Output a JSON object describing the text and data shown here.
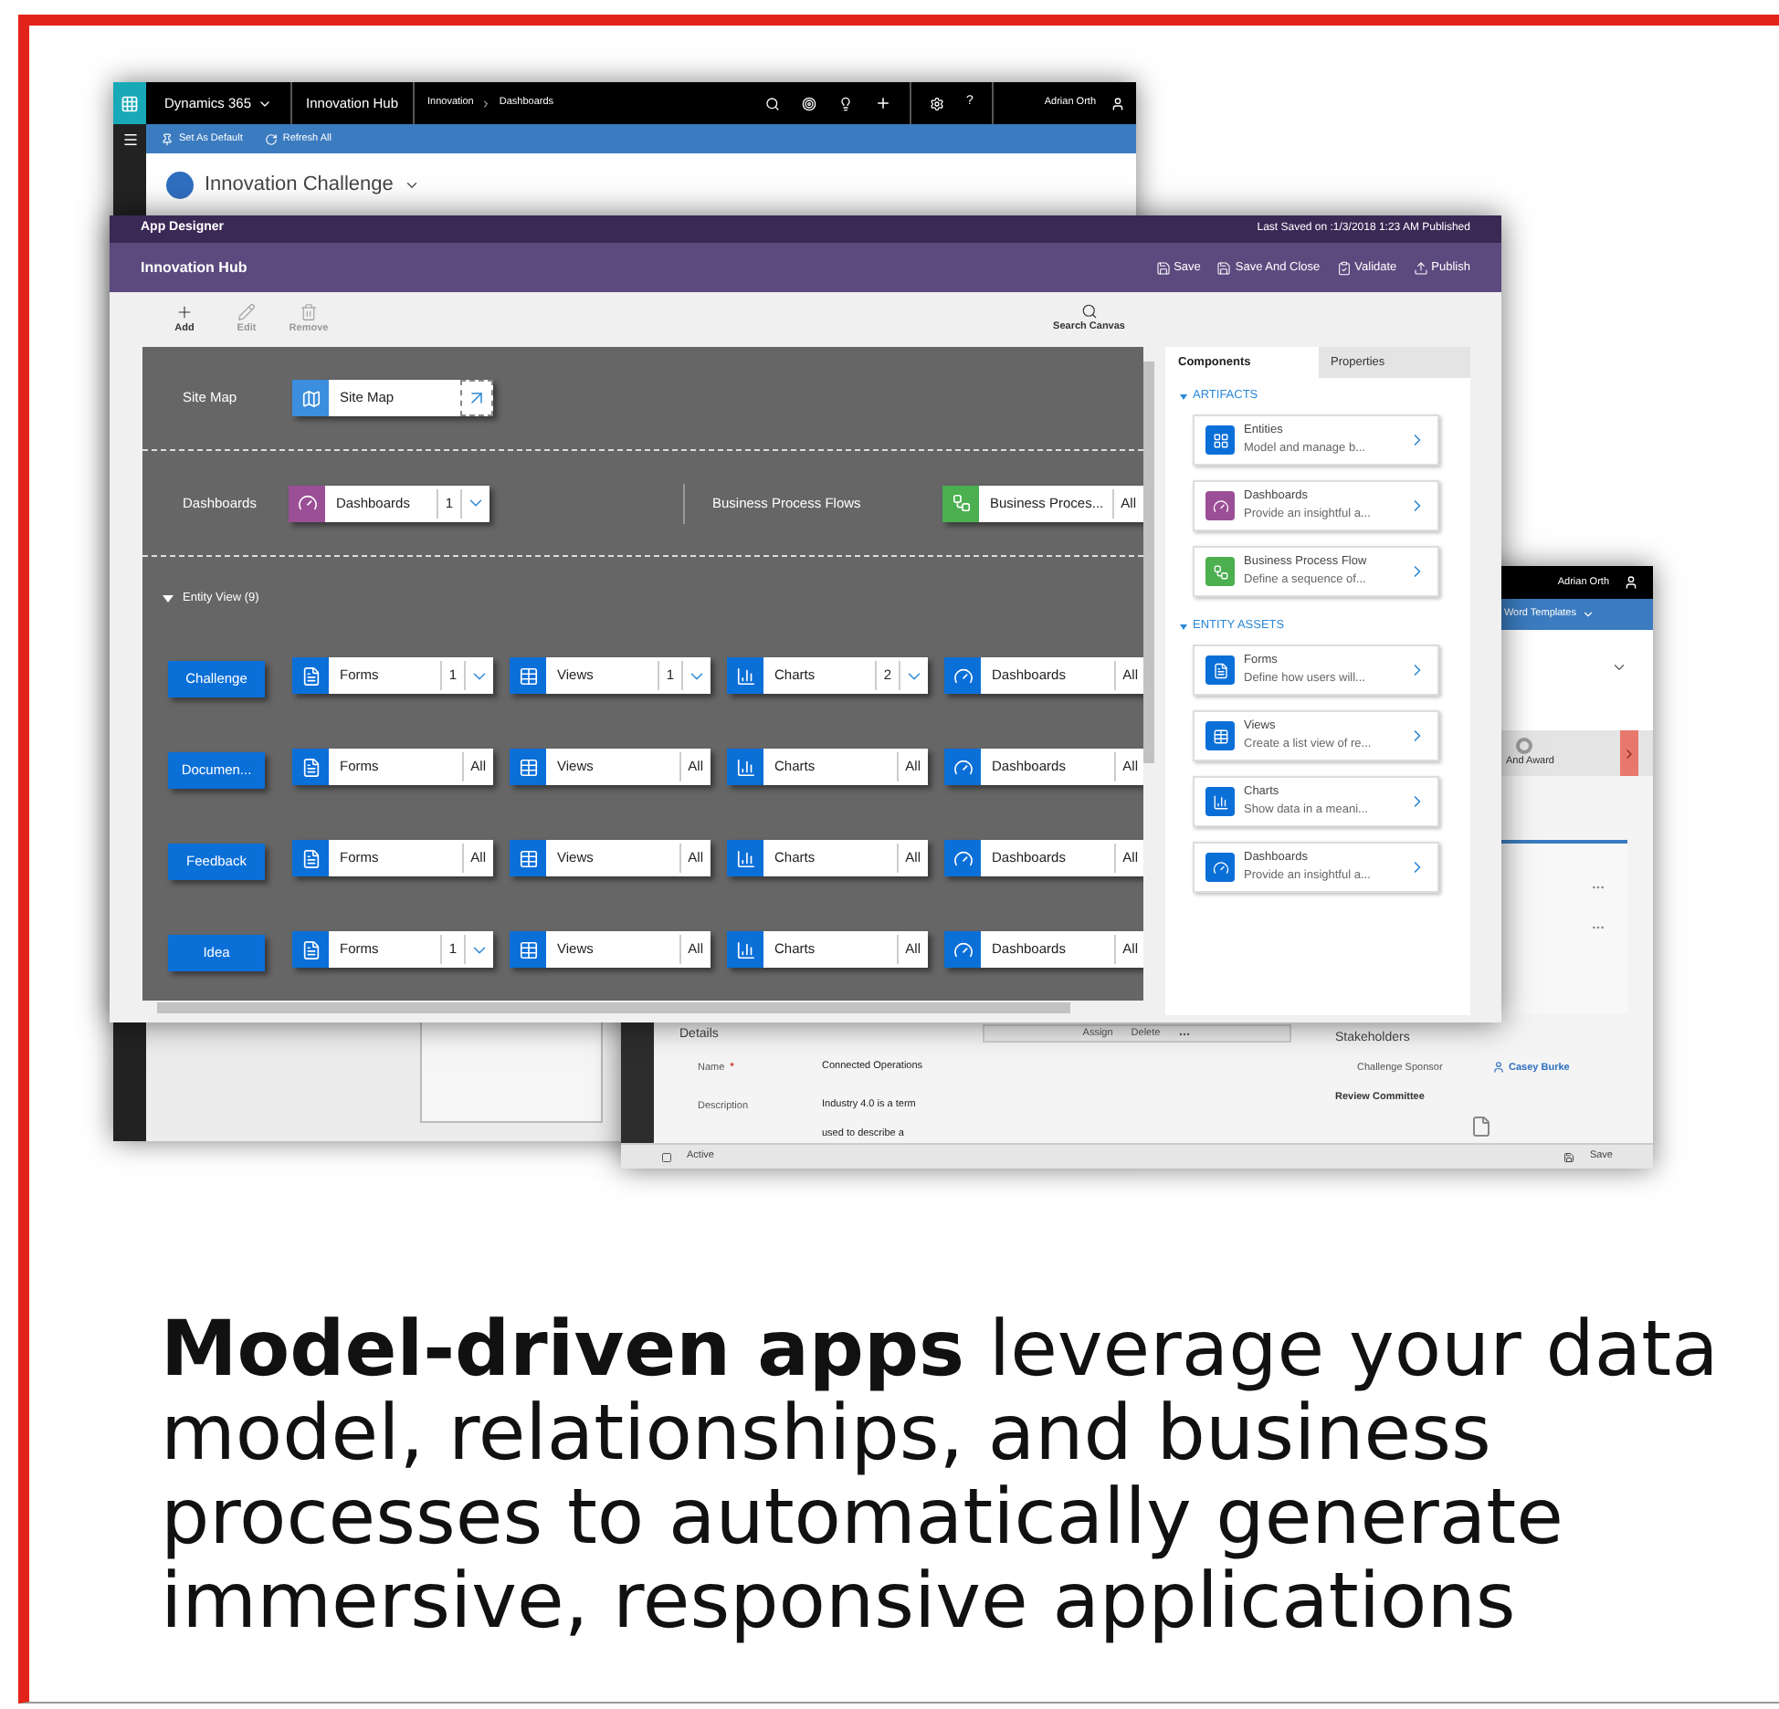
{
  "back_window": {
    "app_name": "Dynamics 365",
    "app": "Innovation Hub",
    "breadcrumb": [
      "Innovation",
      "Dashboards"
    ],
    "help": "?",
    "user": "Adrian Orth",
    "commands": [
      "Set As Default",
      "Refresh All"
    ],
    "dashboard_title": "Innovation Challenge"
  },
  "record_window": {
    "user": "Adrian Orth",
    "command": "Word Templates",
    "stage": "And Award",
    "details_title": "Details",
    "fields": [
      {
        "label": "Name",
        "required_mark": "*",
        "value": "Connected Operations"
      },
      {
        "label": "Description",
        "value": "Industry 4.0 is a term used to describe a"
      }
    ],
    "actions": [
      "Assign",
      "Delete"
    ],
    "stakeholders_title": "Stakeholders",
    "sponsor_label": "Challenge Sponsor",
    "sponsor": "Casey Burke",
    "committee": "Review Committee",
    "status": "Active",
    "save": "Save"
  },
  "designer": {
    "title": "App Designer",
    "last_saved": "Last Saved on :1/3/2018 1:23 AM Published",
    "app_name": "Innovation Hub",
    "actions": [
      {
        "kind": "save",
        "label": "Save"
      },
      {
        "kind": "save_close",
        "label": "Save And Close"
      },
      {
        "kind": "validate",
        "label": "Validate"
      },
      {
        "kind": "publish",
        "label": "Publish"
      }
    ],
    "toolbar": [
      {
        "kind": "add",
        "label": "Add",
        "disabled": false
      },
      {
        "kind": "edit",
        "label": "Edit",
        "disabled": true
      },
      {
        "kind": "remove",
        "label": "Remove",
        "disabled": true
      }
    ],
    "search": "Search Canvas",
    "site_map": {
      "label": "Site Map",
      "tile": {
        "kind": "sitemap",
        "label": "Site Map"
      }
    },
    "dashboards": {
      "label": "Dashboards",
      "tile": {
        "kind": "app_dashboards",
        "label": "Dashboards",
        "count": "1",
        "dropdown": true
      }
    },
    "process_flows": {
      "label": "Business Process Flows",
      "tile": {
        "kind": "bpf",
        "label": "Business Proces...",
        "count": "All",
        "dropdown": false
      }
    },
    "entity_view": {
      "label": "Entity View (9)",
      "expanded": true
    },
    "entities": [
      {
        "name": "Challenge",
        "assets": [
          {
            "kind": "forms",
            "label": "Forms",
            "count": "1",
            "dropdown": true
          },
          {
            "kind": "views",
            "label": "Views",
            "count": "1",
            "dropdown": true
          },
          {
            "kind": "charts",
            "label": "Charts",
            "count": "2",
            "dropdown": true
          },
          {
            "kind": "dashboards",
            "label": "Dashboards",
            "count": "All",
            "dropdown": false
          }
        ]
      },
      {
        "name": "Documen...",
        "assets": [
          {
            "kind": "forms",
            "label": "Forms",
            "count": "All",
            "dropdown": false
          },
          {
            "kind": "views",
            "label": "Views",
            "count": "All",
            "dropdown": false
          },
          {
            "kind": "charts",
            "label": "Charts",
            "count": "All",
            "dropdown": false
          },
          {
            "kind": "dashboards",
            "label": "Dashboards",
            "count": "All",
            "dropdown": false
          }
        ]
      },
      {
        "name": "Feedback",
        "assets": [
          {
            "kind": "forms",
            "label": "Forms",
            "count": "All",
            "dropdown": false
          },
          {
            "kind": "views",
            "label": "Views",
            "count": "All",
            "dropdown": false
          },
          {
            "kind": "charts",
            "label": "Charts",
            "count": "All",
            "dropdown": false
          },
          {
            "kind": "dashboards",
            "label": "Dashboards",
            "count": "All",
            "dropdown": false
          }
        ]
      },
      {
        "name": "Idea",
        "assets": [
          {
            "kind": "forms",
            "label": "Forms",
            "count": "1",
            "dropdown": true
          },
          {
            "kind": "views",
            "label": "Views",
            "count": "All",
            "dropdown": false
          },
          {
            "kind": "charts",
            "label": "Charts",
            "count": "All",
            "dropdown": false
          },
          {
            "kind": "dashboards",
            "label": "Dashboards",
            "count": "All",
            "dropdown": false
          }
        ]
      }
    ],
    "tabs": [
      {
        "label": "Components",
        "selected": true
      },
      {
        "label": "Properties",
        "selected": false
      }
    ],
    "sections": [
      {
        "title": "ARTIFACTS",
        "expanded": true,
        "items": [
          {
            "kind": "entities",
            "title": "Entities",
            "description": "Model and manage b..."
          },
          {
            "kind": "app_dashboards",
            "title": "Dashboards",
            "description": "Provide an insightful a..."
          },
          {
            "kind": "bpf",
            "title": "Business Process Flow",
            "description": "Define a sequence of..."
          }
        ]
      },
      {
        "title": "ENTITY ASSETS",
        "expanded": true,
        "items": [
          {
            "kind": "forms",
            "title": "Forms",
            "description": "Define how users will..."
          },
          {
            "kind": "views",
            "title": "Views",
            "description": "Create a list view of re..."
          },
          {
            "kind": "charts",
            "title": "Charts",
            "description": "Show data in a meani..."
          },
          {
            "kind": "dashboards",
            "title": "Dashboards",
            "description": "Provide an insightful a..."
          }
        ]
      }
    ]
  },
  "caption": "**Model-driven apps** leverage your data model, relationships, and business processes to automatically generate immersive, responsive applications"
}
